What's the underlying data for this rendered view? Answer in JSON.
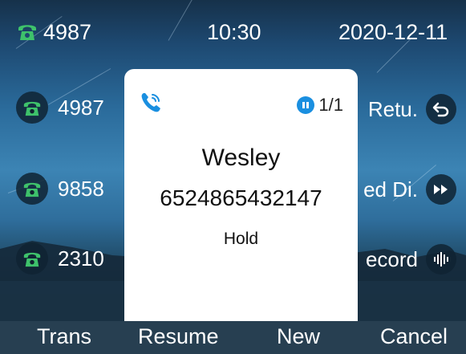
{
  "status_bar": {
    "account": "4987",
    "time": "10:30",
    "date": "2020-12-11",
    "account_icon": "phone-handset-icon"
  },
  "lines": [
    {
      "number": "4987",
      "icon": "phone-handset-icon"
    },
    {
      "number": "9858",
      "icon": "phone-handset-icon"
    },
    {
      "number": "2310",
      "icon": "phone-handset-icon"
    }
  ],
  "right_keys": [
    {
      "label": "Retu.",
      "icon": "return-icon"
    },
    {
      "label": "ed Di.",
      "icon": "fast-forward-icon"
    },
    {
      "label": "ecord",
      "icon": "voice-wave-icon"
    }
  ],
  "popup": {
    "caller_name": "Wesley",
    "caller_number": "6524865432147",
    "call_state": "Hold",
    "call_count": "1/1"
  },
  "softkeys": [
    "Trans",
    "Resume",
    "New",
    "Cancel"
  ],
  "colors": {
    "accent": "#1a8fe0",
    "line_green": "#3ec26b",
    "softkey_bar": "#284052"
  }
}
